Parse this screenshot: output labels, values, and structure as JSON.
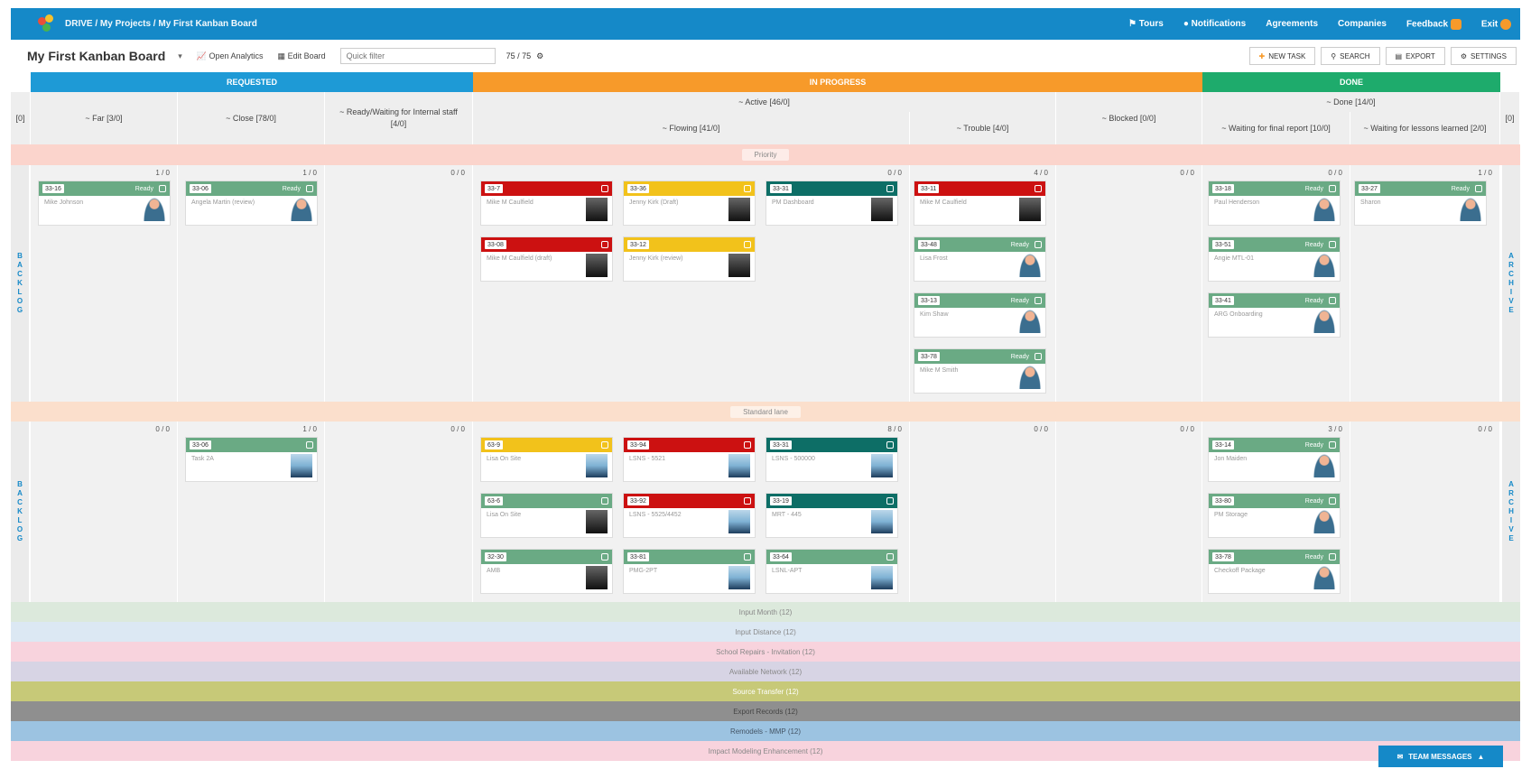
{
  "app": {
    "breadcrumb": "DRIVE / My Projects / My First Kanban Board"
  },
  "top_nav": {
    "tours": "Tours",
    "notifications": "Notifications",
    "item3": "Agreements",
    "item4": "Companies",
    "feedback": "Feedback",
    "exit": "Exit"
  },
  "toolbar": {
    "board_title": "My First Kanban Board",
    "open_analytics": "Open Analytics",
    "edit_board": "Edit Board",
    "filter_placeholder": "Quick filter",
    "count": "75 / 75",
    "new_task": "NEW TASK",
    "search": "SEARCH",
    "export": "EXPORT",
    "settings": "SETTINGS"
  },
  "phases": {
    "requested": "REQUESTED",
    "in_progress": "IN PROGRESS",
    "done": "DONE"
  },
  "columns": {
    "left_count": "[0]",
    "right_count": "[0]",
    "far": "~ Far  [3/0]",
    "close": "~ Close  [78/0]",
    "ready": "~ Ready/Waiting for Internal staff  [4/0]",
    "active": "~ Active  [46/0]",
    "flowing": "~ Flowing  [41/0]",
    "trouble": "~ Trouble  [4/0]",
    "blocked": "~ Blocked  [0/0]",
    "done": "~ Done  [14/0]",
    "waiting_final": "~ Waiting for final report  [10/0]",
    "waiting_lessons": "~ Waiting for lessons learned  [2/0]"
  },
  "side_labels": {
    "backlog": "BACKLOG",
    "archive": "ARCHIVE"
  },
  "lanes": [
    {
      "name": "Priority",
      "color": "#fbd4cc"
    },
    {
      "name": "Standard lane",
      "color": "#fbdfcc"
    },
    {
      "name": "Input Month (12)",
      "color": "#dce9dc"
    },
    {
      "name": "Input Distance (12)",
      "color": "#dce8f3"
    },
    {
      "name": "School Repairs - Invitation (12)",
      "color": "#f8d3dd"
    },
    {
      "name": "Available Network (12)",
      "color": "#d7d4e4"
    },
    {
      "name": "Source Transfer (12)",
      "color": "#c7c978"
    },
    {
      "name": "Export Records (12)",
      "color": "#8f8f8f"
    },
    {
      "name": "Remodels - MMP (12)",
      "color": "#9cc3e1"
    },
    {
      "name": "Impact Modeling Enhancement (12)",
      "color": "#f8d3dd"
    }
  ],
  "col_counts": {
    "r1": [
      "1 / 0",
      "1 / 0",
      "0 / 0",
      "0 / 0",
      "4 / 0",
      "0 / 0",
      "0 / 0",
      "1 / 0"
    ],
    "r2": [
      "0 / 0",
      "1 / 0",
      "0 / 0",
      "8 / 0",
      "0 / 0",
      "0 / 0",
      "3 / 0",
      "0 / 0"
    ]
  },
  "cards": [
    {
      "id": "33-16",
      "status": "Ready",
      "text": "Mike Johnson",
      "color": "#6aaa84",
      "avatar": "person"
    },
    {
      "id": "33-06",
      "status": "Ready",
      "text": "Angela Martin (review)",
      "color": "#6aaa84",
      "avatar": "person"
    },
    {
      "id": "33-7",
      "status": "",
      "text": "Mike M Caulfield",
      "color": "#cc1111",
      "avatar": "photo"
    },
    {
      "id": "33-36",
      "status": "",
      "text": "Jenny Kirk (Draft)",
      "color": "#f2c21b",
      "avatar": "photo"
    },
    {
      "id": "33-31",
      "status": "",
      "text": "PM Dashboard",
      "color": "#0d6e66",
      "avatar": "photo"
    },
    {
      "id": "33-08",
      "status": "",
      "text": "Mike M Caulfield (draft)",
      "color": "#cc1111",
      "avatar": "photo"
    },
    {
      "id": "33-11",
      "status": "",
      "text": "Mike M Caulfield",
      "color": "#cc1111",
      "avatar": "photo"
    },
    {
      "id": "33-12",
      "status": "",
      "text": "Jenny Kirk (review)",
      "color": "#f2c21b",
      "avatar": "photo"
    },
    {
      "id": "33-48",
      "status": "Ready",
      "text": "Lisa Frost",
      "color": "#6aaa84",
      "avatar": "person"
    },
    {
      "id": "33-18",
      "status": "Ready",
      "text": "Paul Henderson",
      "color": "#6aaa84",
      "avatar": "person"
    },
    {
      "id": "33-13",
      "status": "Ready",
      "text": "Kim Shaw",
      "color": "#6aaa84",
      "avatar": "person"
    },
    {
      "id": "33-78",
      "status": "Ready",
      "text": "Mike M Smith",
      "color": "#6aaa84",
      "avatar": "person"
    },
    {
      "id": "33-27",
      "status": "Ready",
      "text": "Sharon",
      "color": "#6aaa84",
      "avatar": "person"
    },
    {
      "id": "33-51",
      "status": "Ready",
      "text": "Angie MTL-01",
      "color": "#6aaa84",
      "avatar": "person"
    },
    {
      "id": "33-41",
      "status": "Ready",
      "text": "ARG Onboarding",
      "color": "#6aaa84",
      "avatar": "person"
    },
    {
      "id": "33-06",
      "status": "",
      "text": "Task 2A",
      "color": "#6aaa84",
      "avatar": "sil"
    },
    {
      "id": "63-9",
      "status": "",
      "text": "Lisa On Site",
      "color": "#f2c21b",
      "avatar": "sil"
    },
    {
      "id": "33-94",
      "status": "",
      "text": "LSNS - 5521",
      "color": "#cc1111",
      "avatar": "sil"
    },
    {
      "id": "33-31",
      "status": "",
      "text": "LSNS - 500000",
      "color": "#0d6e66",
      "avatar": "sil"
    },
    {
      "id": "63-6",
      "status": "",
      "text": "Lisa On Site",
      "color": "#6aaa84",
      "avatar": "photo"
    },
    {
      "id": "33-92",
      "status": "",
      "text": "LSNS - 5525/4452",
      "color": "#cc1111",
      "avatar": "sil"
    },
    {
      "id": "33-19",
      "status": "",
      "text": "MRT - 445",
      "color": "#0d6e66",
      "avatar": "sil"
    },
    {
      "id": "32-30",
      "status": "",
      "text": "AMB",
      "color": "#6aaa84",
      "avatar": "photo"
    },
    {
      "id": "33-81",
      "status": "",
      "text": "PMG-2PT",
      "color": "#6aaa84",
      "avatar": "sil"
    },
    {
      "id": "33-64",
      "status": "",
      "text": "LSNL-APT",
      "color": "#6aaa84",
      "avatar": "sil"
    },
    {
      "id": "33-14",
      "status": "Ready",
      "text": "Jon Maiden",
      "color": "#6aaa84",
      "avatar": "person"
    },
    {
      "id": "33-80",
      "status": "Ready",
      "text": "PM Storage",
      "color": "#6aaa84",
      "avatar": "person"
    },
    {
      "id": "33-78",
      "status": "Ready",
      "text": "Checkoff Package",
      "color": "#6aaa84",
      "avatar": "person"
    }
  ],
  "footer": {
    "messages": "TEAM MESSAGES"
  },
  "colors": {
    "blue": "#1589c8",
    "orange": "#f79a2a",
    "green": "#1eab6c"
  }
}
